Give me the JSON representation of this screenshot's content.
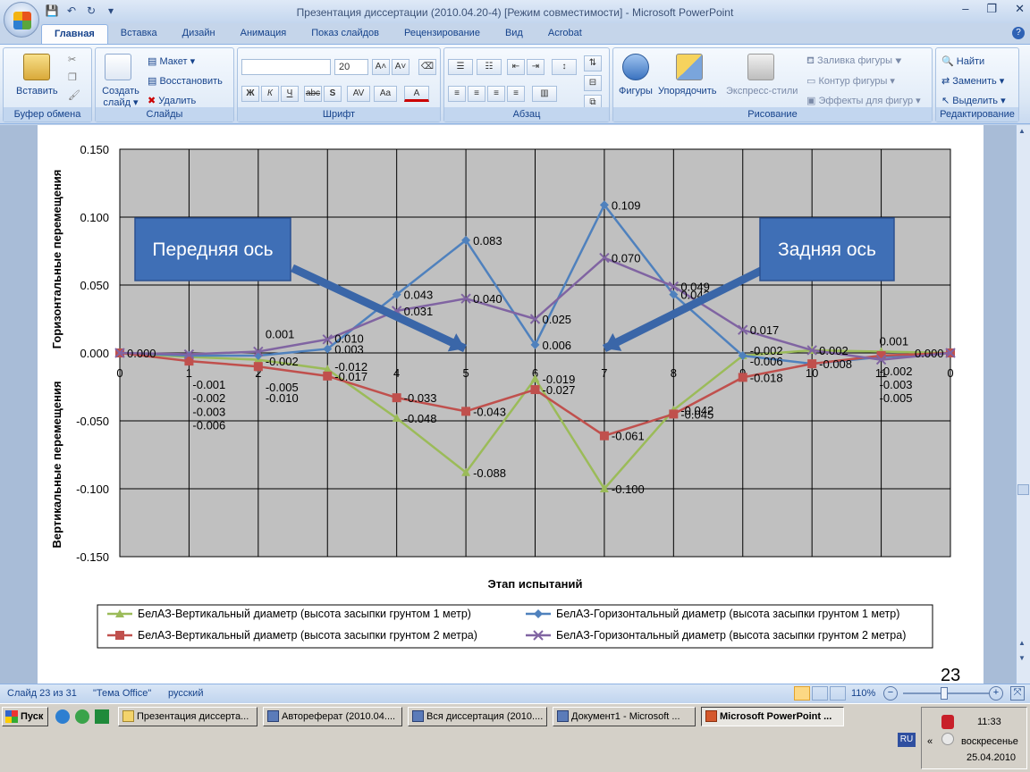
{
  "window": {
    "title": "Презентация диссертации (2010.04.20-4) [Режим совместимости] - Microsoft PowerPoint",
    "minimize": "–",
    "maximize": "❐",
    "close": "✕"
  },
  "tabs": [
    "Главная",
    "Вставка",
    "Дизайн",
    "Анимация",
    "Показ слайдов",
    "Рецензирование",
    "Вид",
    "Acrobat"
  ],
  "ribbon": {
    "clipboard": {
      "label": "Буфер обмена",
      "paste": "Вставить"
    },
    "slides": {
      "label": "Слайды",
      "new_slide": "Создать слайд ▾",
      "layout": "Макет ▾",
      "reset": "Восстановить",
      "delete": "Удалить"
    },
    "font": {
      "label": "Шрифт",
      "font_name": "",
      "font_size": "20",
      "bold": "Ж",
      "italic": "К",
      "underline": "Ч",
      "strike": "abc",
      "shadow": "S",
      "spacing": "AV",
      "case": "Aa",
      "color": "A"
    },
    "paragraph": {
      "label": "Абзац"
    },
    "drawing": {
      "label": "Рисование",
      "shapes": "Фигуры",
      "arrange": "Упорядочить",
      "quick_styles": "Экспресс-стили",
      "fill": "Заливка фигуры ▾",
      "outline": "Контур фигуры ▾",
      "effects": "Эффекты для фигур ▾"
    },
    "editing": {
      "label": "Редактирование",
      "find": "Найти",
      "replace": "Заменить ▾",
      "select": "Выделить ▾"
    }
  },
  "slide": {
    "callout_front": "Передняя ось",
    "callout_rear": "Задняя ось",
    "page_number": "23"
  },
  "chart_data": {
    "type": "line",
    "title": "",
    "xlabel": "Этап испытаний",
    "ylabel_top": "Горизонтальные перемещения",
    "ylabel_bottom": "Вертикальные перемещения",
    "ylim": [
      -0.15,
      0.15
    ],
    "yticks": [
      "0.150",
      "0.100",
      "0.050",
      "0.000",
      "-0.050",
      "-0.100",
      "-0.150"
    ],
    "x": [
      0,
      1,
      2,
      3,
      4,
      5,
      6,
      7,
      8,
      9,
      10,
      11,
      0
    ],
    "grid": true,
    "legend_position": "bottom",
    "series": [
      {
        "name": "БелАЗ-Вертикальный диаметр (высота засыпки грунтом 1 метр)",
        "color": "#9bbb59",
        "marker": "triangle",
        "values": [
          0.0,
          -0.003,
          -0.005,
          -0.012,
          -0.048,
          -0.088,
          -0.019,
          -0.1,
          -0.042,
          -0.002,
          0.002,
          0.001,
          0.0
        ]
      },
      {
        "name": "БелАЗ-Горизонтальный диаметр (высота засыпки грунтом 1 метр)",
        "color": "#4f81bd",
        "marker": "diamond",
        "values": [
          0.0,
          -0.002,
          -0.002,
          0.003,
          0.043,
          0.083,
          0.006,
          0.109,
          0.043,
          -0.002,
          -0.008,
          -0.003,
          0.0
        ]
      },
      {
        "name": "БелАЗ-Вертикальный диаметр (высота засыпки грунтом 2 метра)",
        "color": "#c0504d",
        "marker": "square",
        "values": [
          0.0,
          -0.006,
          -0.01,
          -0.017,
          -0.033,
          -0.043,
          -0.027,
          -0.061,
          -0.045,
          -0.018,
          -0.008,
          -0.002,
          0.0
        ]
      },
      {
        "name": "БелАЗ-Горизонтальный диаметр (высота засыпки грунтом 2 метра)",
        "color": "#8064a2",
        "marker": "x",
        "values": [
          0.0,
          -0.001,
          0.001,
          0.01,
          0.031,
          0.04,
          0.025,
          0.07,
          0.049,
          0.017,
          0.002,
          -0.005,
          0.0
        ]
      }
    ],
    "data_labels": [
      "0.150",
      "0.000",
      "0.000",
      "-0.001",
      "-0.002",
      "-0.003",
      "-0.006",
      "-0.002",
      "-0.005",
      "-0.010",
      "0.001",
      "0.010",
      "0.003",
      "-0.012",
      "-0.017",
      "0.043",
      "0.031",
      "-0.033",
      "-0.048",
      "0.083",
      "0.040",
      "-0.043",
      "-0.088",
      "0.025",
      "0.006",
      "-0.019",
      "-0.027",
      "0.109",
      "0.070",
      "-0.061",
      "-0.100",
      "0.049",
      "0.043",
      "-0.042",
      "-0.045",
      "0.017",
      "-0.002",
      "-0.006",
      "-0.018",
      "0.002",
      "-0.008",
      "0.001",
      "-0.002",
      "-0.003",
      "-0.005",
      "0.000"
    ]
  },
  "status": {
    "slide": "Слайд 23 из 31",
    "theme": "\"Тема Office\"",
    "lang": "русский",
    "zoom": "110%"
  },
  "taskbar": {
    "start": "Пуск",
    "tasks": [
      "Презентация диссерта...",
      "Автореферат (2010.04....",
      "Вся диссертация (2010....",
      "Документ1 - Microsoft ...",
      "Microsoft PowerPoint ..."
    ],
    "lang": "RU",
    "time": "11:33",
    "day": "воскресенье",
    "date": "25.04.2010"
  }
}
